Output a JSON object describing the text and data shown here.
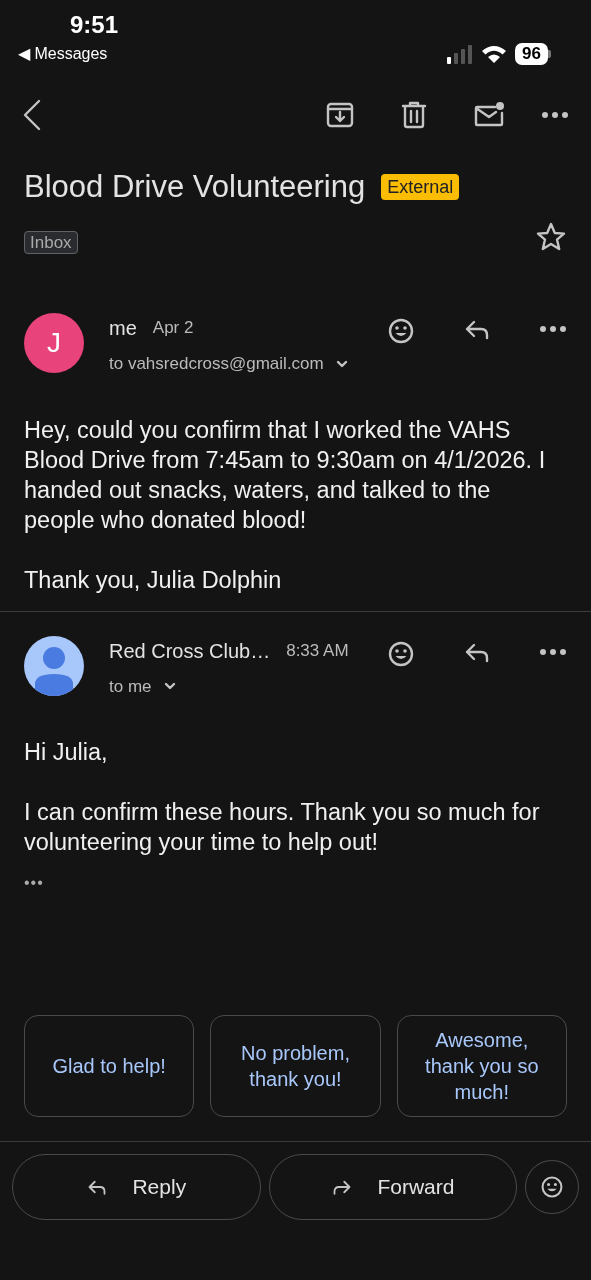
{
  "status_bar": {
    "time": "9:51",
    "back_label": "◀ Messages",
    "battery": "96"
  },
  "subject": {
    "title": "Blood Drive Volunteering",
    "tag": "External",
    "label": "Inbox",
    "starred": false
  },
  "messages": [
    {
      "avatar": {
        "kind": "letter",
        "letter": "J"
      },
      "sender": "me",
      "date": "Apr 2",
      "recipient": "to vahsredcross@gmail.com",
      "paragraphs": [
        "Hey, could you confirm that I worked the VAHS Blood Drive from 7:45am to 9:30am on 4/1/2026. I handed out snacks, waters, and talked to the people who donated blood!",
        "Thank you, Julia Dolphin"
      ]
    },
    {
      "avatar": {
        "kind": "person"
      },
      "sender": "Red Cross Club…",
      "date": "8:33 AM",
      "recipient": "to me",
      "paragraphs": [
        "Hi Julia,",
        "I can confirm these hours. Thank you so much for volunteering your time to help out!"
      ],
      "trimmed": "•••"
    }
  ],
  "smart_replies": [
    "Glad to help!",
    "No problem, thank you!",
    "Awesome, thank you so much!"
  ],
  "actions": [
    {
      "kind": "reply",
      "label": "Reply"
    },
    {
      "kind": "forward",
      "label": "Forward"
    }
  ]
}
